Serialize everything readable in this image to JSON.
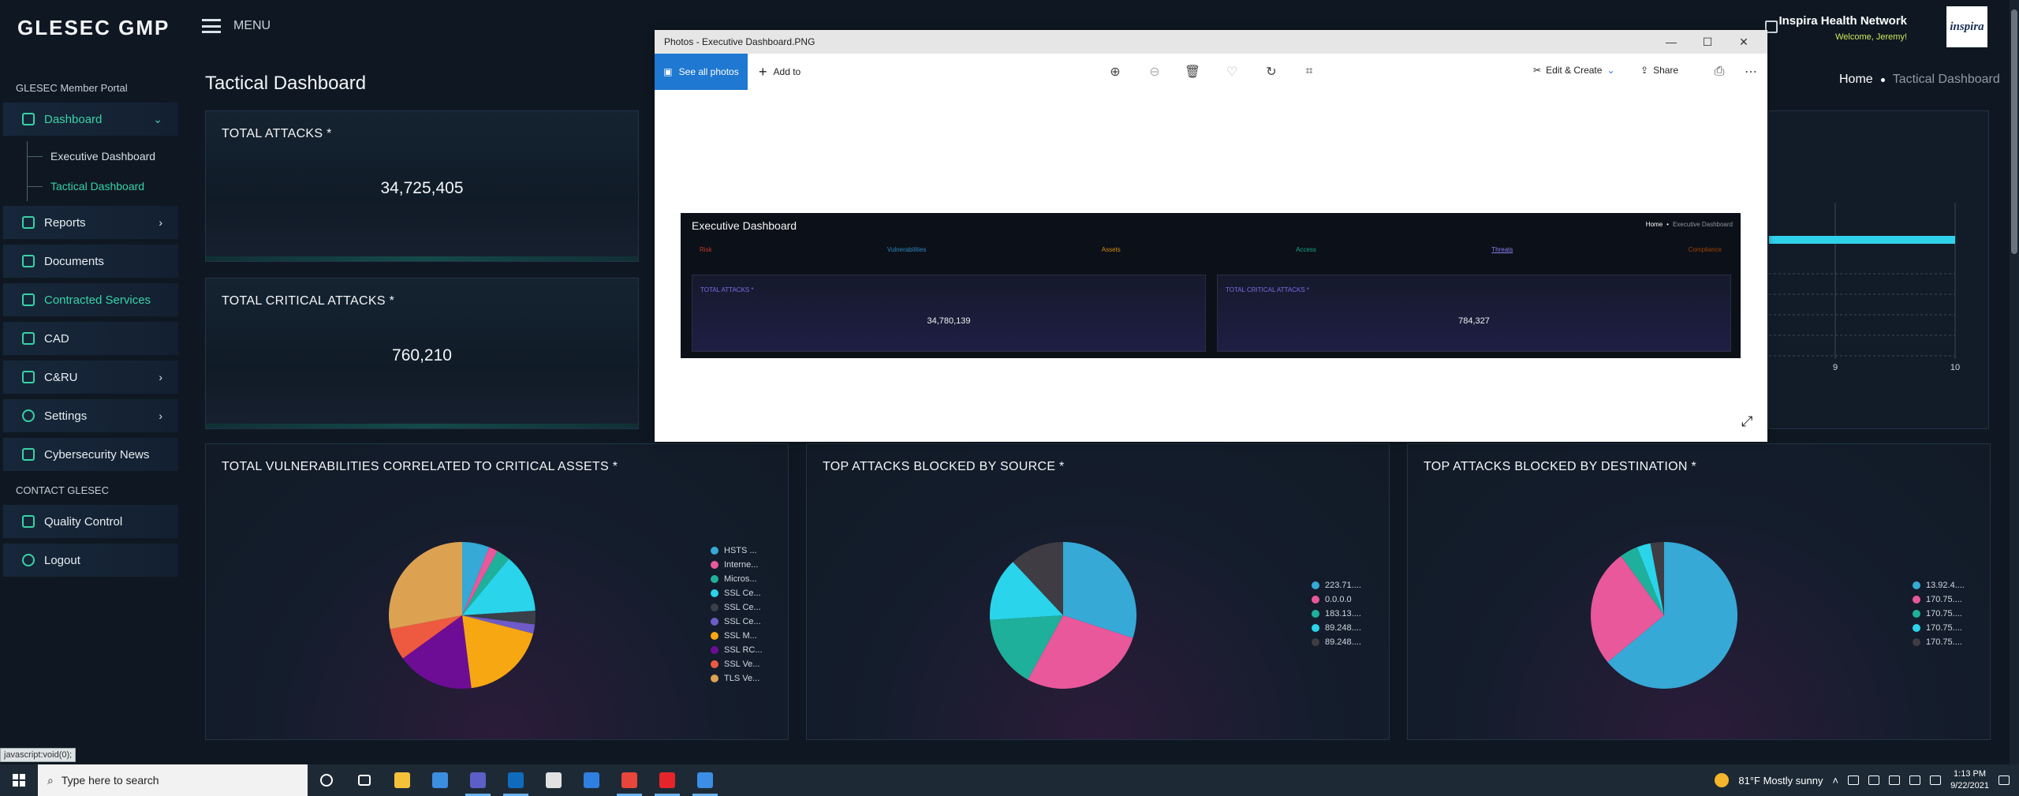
{
  "topbar": {
    "brand": "GLESEC GMP",
    "menu_label": "MENU",
    "org_name": "Inspira Health Network",
    "welcome": "Welcome, Jeremy!",
    "logo_text": "inspira"
  },
  "sidebar": {
    "section_portal": "GLESEC Member Portal",
    "items": [
      {
        "label": "Dashboard"
      },
      {
        "label": "Reports"
      },
      {
        "label": "Documents"
      },
      {
        "label": "Contracted Services"
      },
      {
        "label": "CAD"
      },
      {
        "label": "C&RU"
      },
      {
        "label": "Settings"
      },
      {
        "label": "Cybersecurity News"
      }
    ],
    "sub_items": [
      {
        "label": "Executive Dashboard"
      },
      {
        "label": "Tactical Dashboard"
      }
    ],
    "section_contact": "CONTACT GLESEC",
    "contact_items": [
      {
        "label": "Quality Control"
      },
      {
        "label": "Logout"
      }
    ],
    "status_url": "javascript:void(0);"
  },
  "main": {
    "page_title": "Tactical Dashboard",
    "breadcrumb": {
      "home": "Home",
      "current": "Tactical Dashboard"
    },
    "cards": [
      {
        "title": "TOTAL ATTACKS *",
        "value": "34,725,405"
      },
      {
        "title": "TOTAL CRITICAL ATTACKS *",
        "value": "760,210"
      }
    ],
    "right_chart_ticks": [
      "9",
      "10"
    ]
  },
  "chart_data": [
    {
      "type": "pie",
      "title": "TOTAL VULNERABILITIES CORRELATED TO CRITICAL ASSETS *",
      "labels": [
        "HSTS ...",
        "Interne...",
        "Micros...",
        "SSL Ce...",
        "SSL Ce...",
        "SSL Ce...",
        "SSL M...",
        "SSL RC...",
        "SSL Ve...",
        "TLS Ve..."
      ],
      "values": [
        6,
        2,
        3,
        13,
        3,
        2,
        19,
        17,
        7,
        28
      ],
      "colors": [
        "#36a9d6",
        "#e8589a",
        "#1fb09b",
        "#2ad4ea",
        "#3b3f47",
        "#6e5bc9",
        "#f7a712",
        "#6d0d96",
        "#ee5a40",
        "#dca252"
      ]
    },
    {
      "type": "pie",
      "title": "TOP ATTACKS BLOCKED BY SOURCE *",
      "labels": [
        "223.71....",
        "0.0.0.0",
        "183.13....",
        "89.248....",
        "89.248...."
      ],
      "values": [
        30,
        28,
        16,
        14,
        12
      ],
      "colors": [
        "#36a9d6",
        "#e8589a",
        "#1fb09b",
        "#2ad4ea",
        "#3f3d43"
      ]
    },
    {
      "type": "pie",
      "title": "TOP ATTACKS BLOCKED BY DESTINATION *",
      "labels": [
        "13.92.4....",
        "170.75....",
        "170.75....",
        "170.75....",
        "170.75...."
      ],
      "values": [
        64,
        26,
        4,
        3,
        3
      ],
      "colors": [
        "#36a9d6",
        "#e8589a",
        "#1fb09b",
        "#2ad4ea",
        "#3f3d43"
      ]
    }
  ],
  "photos": {
    "window_title": "Photos - Executive Dashboard.PNG",
    "see_all": "See all photos",
    "add_to": "Add to",
    "edit_create": "Edit & Create",
    "share": "Share",
    "inner": {
      "title": "Executive Dashboard",
      "bc_home": "Home",
      "bc_current": "Executive Dashboard",
      "tabs": [
        {
          "label": "Risk",
          "color": "#c0392b"
        },
        {
          "label": "Vulnerabilities",
          "color": "#2e86c1"
        },
        {
          "label": "Assets",
          "color": "#d68910"
        },
        {
          "label": "Access",
          "color": "#17a589"
        },
        {
          "label": "Threats",
          "color": "#8e7cf0"
        },
        {
          "label": "Compliance",
          "color": "#a04000"
        }
      ],
      "cards": [
        {
          "title": "TOTAL ATTACKS *",
          "value": "34,780,139"
        },
        {
          "title": "TOTAL CRITICAL ATTACKS *",
          "value": "784,327"
        }
      ]
    }
  },
  "taskbar": {
    "search_placeholder": "Type here to search",
    "weather": "81°F  Mostly sunny",
    "time": "1:13 PM",
    "date": "9/22/2021",
    "apps": [
      {
        "name": "cortana",
        "color": "#ffffff"
      },
      {
        "name": "task-view",
        "color": "#ffffff"
      },
      {
        "name": "file-explorer",
        "color": "#f3c13a"
      },
      {
        "name": "store",
        "color": "#3b8de0"
      },
      {
        "name": "teams",
        "color": "#5b5fc7"
      },
      {
        "name": "outlook",
        "color": "#0f6cbd"
      },
      {
        "name": "app-red",
        "color": "#e1e1e1"
      },
      {
        "name": "todo",
        "color": "#2f7fe0"
      },
      {
        "name": "chrome",
        "color": "#e8453c"
      },
      {
        "name": "acrobat",
        "color": "#e5252a"
      },
      {
        "name": "photos",
        "color": "#3a8ee6"
      }
    ]
  }
}
